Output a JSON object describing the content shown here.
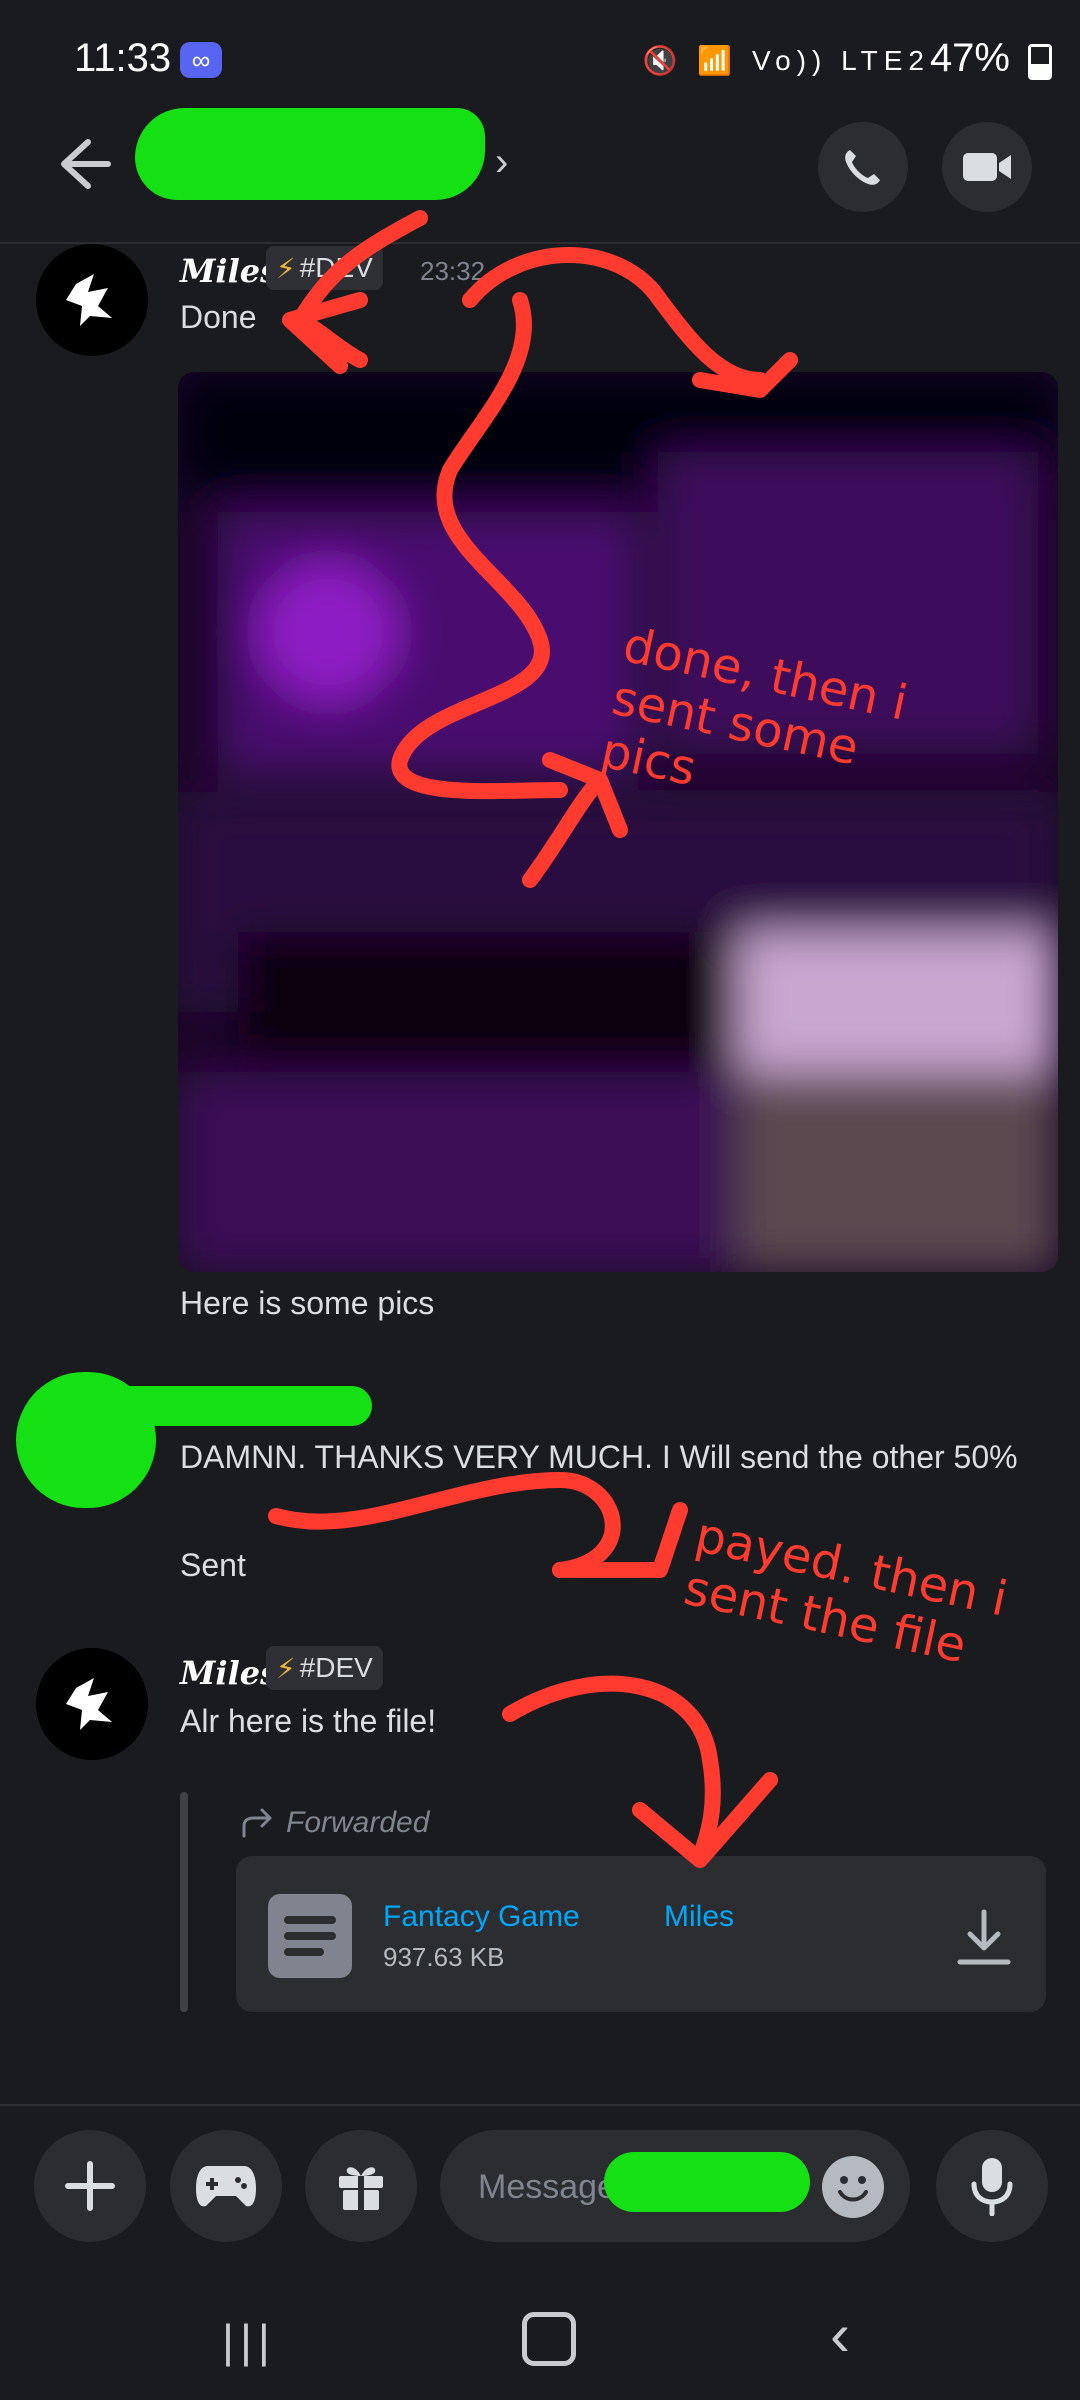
{
  "status_bar": {
    "time": "11:33",
    "network_icons": "🔇 📶 Vo)) LTE2",
    "battery": "47%"
  },
  "header": {
    "back_icon": "arrow-left-icon",
    "chevron": "›",
    "call_icon": "phone-icon",
    "video_icon": "video-camera-icon"
  },
  "messages": {
    "group1": {
      "username": "Miles",
      "tag": "#DEV",
      "timestamp": "23:32",
      "text": "Done",
      "caption": "Here is some pics"
    },
    "group2": {
      "line1": "DAMNN. THANKS VERY MUCH. I Will send the other 50%",
      "line2": "Sent"
    },
    "group3": {
      "username": "Miles",
      "tag": "#DEV",
      "text": "Alr here is the file!",
      "forwarded_label": "Forwarded",
      "file": {
        "name": "Fantacy Game",
        "author": "Miles",
        "size": "937.63 KB"
      }
    }
  },
  "annotations": {
    "first": "done, then i\nsent some\npics",
    "second": "payed. then i\nsent the file"
  },
  "composer": {
    "placeholder": "Message"
  },
  "colors": {
    "background": "#1a1b1e",
    "link": "#00a8fc",
    "annotation": "#ff3b30",
    "redaction": "#14e014"
  }
}
